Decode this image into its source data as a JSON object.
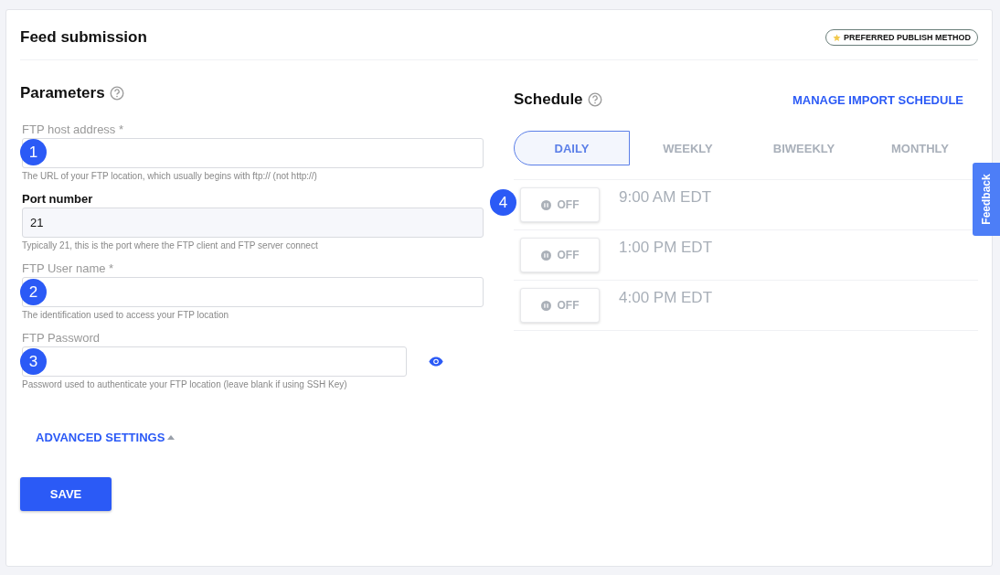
{
  "title": "Feed submission",
  "badge": "PREFERRED PUBLISH METHOD",
  "parameters": {
    "heading": "Parameters",
    "fields": [
      {
        "kind": "text",
        "label": "FTP host address *",
        "help": "The URL of your FTP location, which usually begins with ftp:// (not http://)",
        "marker": "1"
      },
      {
        "kind": "text",
        "label": "Port number",
        "value": "21",
        "help": "Typically 21, this is the port where the FTP client and FTP server connect"
      },
      {
        "kind": "text",
        "label": "FTP User name *",
        "help": "The identification used to access your FTP location",
        "marker": "2"
      },
      {
        "kind": "password",
        "label": "FTP Password",
        "help": "Password used to authenticate your FTP location (leave blank if using SSH Key)",
        "marker": "3"
      }
    ],
    "advanced": "ADVANCED SETTINGS",
    "save": "SAVE"
  },
  "schedule": {
    "heading": "Schedule",
    "manage": "MANAGE IMPORT SCHEDULE",
    "tabs": [
      {
        "label": "DAILY",
        "selected": true
      },
      {
        "label": "WEEKLY",
        "selected": false
      },
      {
        "label": "BIWEEKLY",
        "selected": false
      },
      {
        "label": "MONTHLY",
        "selected": false
      }
    ],
    "rows": [
      {
        "toggle": "OFF",
        "on": false,
        "time": "9:00 AM EDT",
        "marker": "4"
      },
      {
        "toggle": "OFF",
        "on": false,
        "time": "1:00 PM EDT"
      },
      {
        "toggle": "OFF",
        "on": false,
        "time": "4:00 PM EDT"
      }
    ]
  },
  "feedback": "Feedback"
}
